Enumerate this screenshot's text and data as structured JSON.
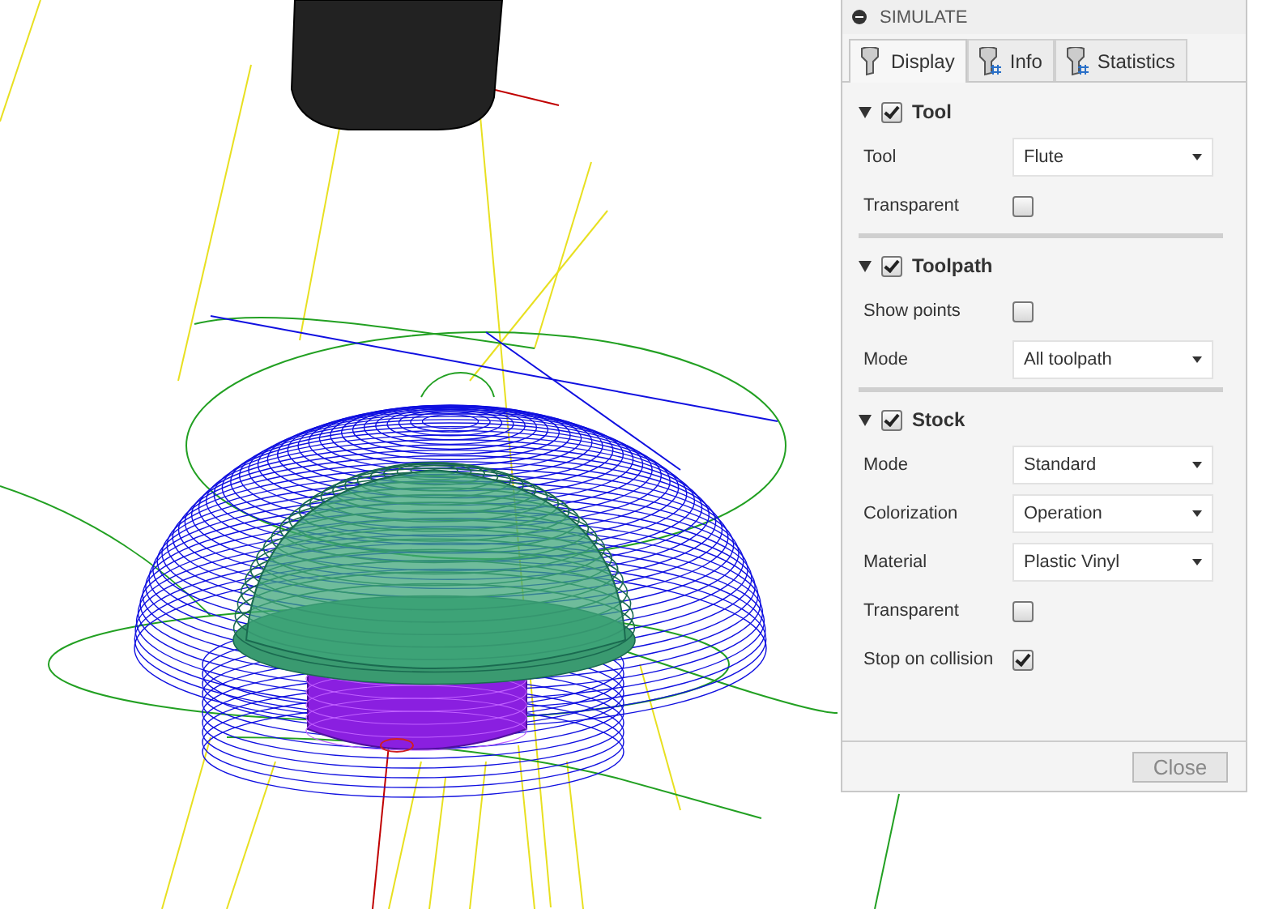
{
  "panel": {
    "title": "SIMULATE",
    "tabs": [
      {
        "label": "Display",
        "selected": true
      },
      {
        "label": "Info",
        "selected": false
      },
      {
        "label": "Statistics",
        "selected": false
      }
    ],
    "sections": [
      {
        "title": "Tool",
        "expanded": true,
        "checked": true,
        "rows": [
          {
            "kind": "dropdown",
            "label": "Tool",
            "value": "Flute"
          },
          {
            "kind": "checkbox",
            "label": "Transparent",
            "checked": false
          }
        ]
      },
      {
        "title": "Toolpath",
        "expanded": true,
        "checked": true,
        "rows": [
          {
            "kind": "checkbox",
            "label": "Show points",
            "checked": false
          },
          {
            "kind": "dropdown",
            "label": "Mode",
            "value": "All toolpath"
          }
        ]
      },
      {
        "title": "Stock",
        "expanded": true,
        "checked": true,
        "rows": [
          {
            "kind": "dropdown",
            "label": "Mode",
            "value": "Standard"
          },
          {
            "kind": "dropdown",
            "label": "Colorization",
            "value": "Operation"
          },
          {
            "kind": "dropdown",
            "label": "Material",
            "value": "Plastic Vinyl"
          },
          {
            "kind": "checkbox",
            "label": "Transparent",
            "checked": false
          },
          {
            "kind": "checkbox",
            "label": "Stop on collision",
            "checked": true
          }
        ]
      }
    ],
    "close_button": "Close"
  }
}
